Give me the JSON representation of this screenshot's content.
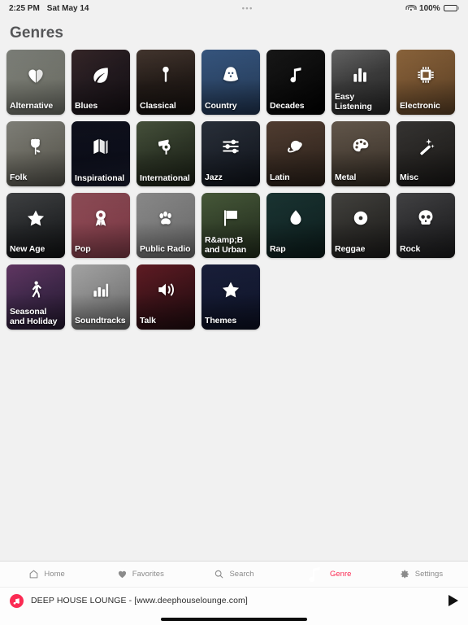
{
  "statusbar": {
    "time": "2:25 PM",
    "date": "Sat May 14",
    "dots": "•••",
    "battery_percent": "100%",
    "wifi_icon": "wifi-icon",
    "battery_icon": "battery-full-icon"
  },
  "header": {
    "title": "Genres"
  },
  "grid": {
    "tiles": [
      {
        "label": "Alternative",
        "icon": "broken-heart-icon",
        "bg": "bg-alternative"
      },
      {
        "label": "Blues",
        "icon": "leaf-icon",
        "bg": "bg-blues"
      },
      {
        "label": "Classical",
        "icon": "music-pin-icon",
        "bg": "bg-classical"
      },
      {
        "label": "Country",
        "icon": "cowboy-hat-icon",
        "bg": "bg-country"
      },
      {
        "label": "Decades",
        "icon": "music-note-icon",
        "bg": "bg-decades"
      },
      {
        "label": "Easy Listening",
        "icon": "equalizer-bars-icon",
        "bg": "bg-easy"
      },
      {
        "label": "Electronic",
        "icon": "cpu-chip-icon",
        "bg": "bg-electronic"
      },
      {
        "label": "Folk",
        "icon": "rose-icon",
        "bg": "bg-folk"
      },
      {
        "label": "Inspirational",
        "icon": "map-icon",
        "bg": "bg-inspirational"
      },
      {
        "label": "International",
        "icon": "globe-stand-icon",
        "bg": "bg-international"
      },
      {
        "label": "Jazz",
        "icon": "sliders-icon",
        "bg": "bg-jazz"
      },
      {
        "label": "Latin",
        "icon": "planet-icon",
        "bg": "bg-latin"
      },
      {
        "label": "Metal",
        "icon": "palette-icon",
        "bg": "bg-metal"
      },
      {
        "label": "Misc",
        "icon": "magic-wand-icon",
        "bg": "bg-misc"
      },
      {
        "label": "New Age",
        "icon": "star-icon",
        "bg": "bg-newage"
      },
      {
        "label": "Pop",
        "icon": "award-rosette-icon",
        "bg": "bg-pop"
      },
      {
        "label": "Public Radio",
        "icon": "paw-print-icon",
        "bg": "bg-publicradio"
      },
      {
        "label": "R&amp;B and Urban",
        "icon": "flag-icon",
        "bg": "bg-rnb"
      },
      {
        "label": "Rap",
        "icon": "flame-drop-icon",
        "bg": "bg-rap"
      },
      {
        "label": "Reggae",
        "icon": "vinyl-record-icon",
        "bg": "bg-reggae"
      },
      {
        "label": "Rock",
        "icon": "skull-icon",
        "bg": "bg-rock"
      },
      {
        "label": "Seasonal and Holiday",
        "icon": "walking-person-icon",
        "bg": "bg-seasonal"
      },
      {
        "label": "Soundtracks",
        "icon": "bar-chart-icon",
        "bg": "bg-soundtracks"
      },
      {
        "label": "Talk",
        "icon": "speaker-waves-icon",
        "bg": "bg-talk"
      },
      {
        "label": "Themes",
        "icon": "star-icon",
        "bg": "bg-themes"
      }
    ]
  },
  "tabbar": {
    "active": "Genre",
    "items": [
      {
        "label": "Home",
        "icon": "home-icon"
      },
      {
        "label": "Favorites",
        "icon": "heart-icon"
      },
      {
        "label": "Search",
        "icon": "search-icon"
      },
      {
        "label": "Genre",
        "icon": "music-note-icon"
      },
      {
        "label": "Settings",
        "icon": "gear-icon"
      }
    ]
  },
  "nowplaying": {
    "title": "DEEP HOUSE LOUNGE - [www.deephouselounge.com]",
    "app_icon": "music-app-icon",
    "play_icon": "play-icon"
  },
  "colors": {
    "accent": "#fb2b53",
    "background": "#f1f1f1",
    "title": "#555658",
    "tab_inactive": "#8b8b8b"
  }
}
